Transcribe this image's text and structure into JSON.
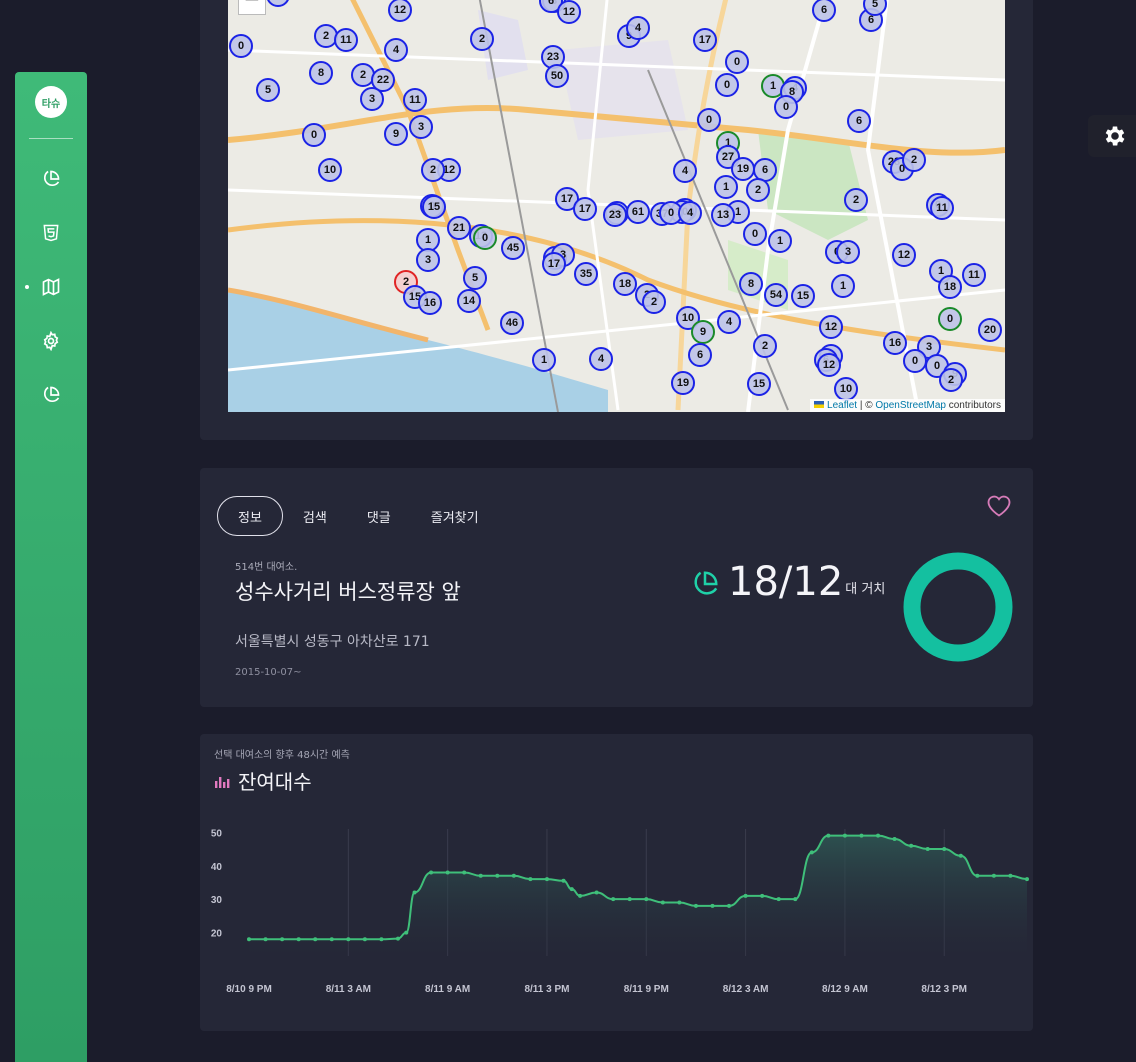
{
  "sidebar": {
    "logo_text": "타슈",
    "items": [
      {
        "name": "dashboard",
        "icon": "pie-chart-icon"
      },
      {
        "name": "html5",
        "icon": "html5-icon"
      },
      {
        "name": "map",
        "icon": "map-icon",
        "active": true
      },
      {
        "name": "settings",
        "icon": "gear-icon"
      },
      {
        "name": "stats",
        "icon": "pie-chart-icon"
      }
    ]
  },
  "map": {
    "zoom_out": "−",
    "attribution_leaflet": "Leaflet",
    "attribution_sep": " | © ",
    "attribution_osm": "OpenStreetMap",
    "attribution_tail": " contributors",
    "clusters": [
      "0",
      "12",
      "3",
      "6",
      "12",
      "6",
      "0",
      "2",
      "11",
      "4",
      "2",
      "9",
      "4",
      "17",
      "6",
      "0",
      "0",
      "8",
      "2",
      "22",
      "23",
      "1",
      "5",
      "50",
      "0",
      "4",
      "3",
      "11",
      "8",
      "0",
      "6",
      "9",
      "3",
      "0",
      "10",
      "12",
      "2",
      "1",
      "27",
      "28",
      "4",
      "19",
      "6",
      "1",
      "2",
      "0",
      "17",
      "2",
      "4",
      "1",
      "10",
      "0",
      "15",
      "17",
      "26",
      "61",
      "37",
      "23",
      "0",
      "4",
      "0",
      "13",
      "11",
      "21",
      "13",
      "0",
      "0",
      "1",
      "45",
      "4",
      "3",
      "0",
      "3",
      "1",
      "1",
      "12",
      "3",
      "17",
      "35",
      "2",
      "18",
      "5",
      "1",
      "11",
      "2",
      "18",
      "8",
      "1",
      "15",
      "16",
      "54",
      "15",
      "14",
      "2",
      "46",
      "10",
      "9",
      "4",
      "12",
      "0",
      "20",
      "6",
      "16",
      "3",
      "2",
      "1",
      "4",
      "7",
      "0",
      "6",
      "0",
      "12",
      "9",
      "2",
      "19",
      "10",
      "15",
      "5",
      "2"
    ],
    "colors": {
      "cluster_border": "#1b23e6",
      "cluster_fill": "#bec3e8",
      "green_border": "#1a8a2a",
      "red_border": "#e02424"
    }
  },
  "info": {
    "tabs": [
      "정보",
      "검색",
      "댓글",
      "즐겨찾기"
    ],
    "active_tab": "정보",
    "station_no": "514번 대여소.",
    "station_name": "성수사거리 버스정류장 앞",
    "address": "서울특별시 성동구 아차산로 171",
    "since": "2015-10-07~",
    "count_available": "18",
    "count_total": "12",
    "count_unit": "대 거치",
    "ring_color": "#14c0a0"
  },
  "chart": {
    "subtitle": "선택 대여소의 향후 48시간 예측",
    "title": "잔여대수"
  },
  "chart_data": {
    "type": "area",
    "x_ticks": [
      "8/10 9 PM",
      "8/11 3 AM",
      "8/11 9 AM",
      "8/11 3 PM",
      "8/11 9 PM",
      "8/12 3 AM",
      "8/12 9 AM",
      "8/12 3 PM"
    ],
    "y_ticks": [
      20,
      30,
      40,
      50
    ],
    "ylim": [
      13,
      51
    ],
    "x_hours": [
      0,
      1,
      2,
      3,
      4,
      5,
      6,
      7,
      8,
      9,
      9.5,
      10,
      11,
      12,
      13,
      14,
      15,
      16,
      17,
      18,
      19,
      19.5,
      20,
      21,
      22,
      23,
      24,
      25,
      26,
      27,
      28,
      29,
      30,
      31,
      32,
      33,
      34,
      35,
      36,
      37,
      38,
      39,
      40,
      41,
      42,
      43,
      44,
      45,
      46,
      47
    ],
    "values": [
      18,
      18,
      18,
      18,
      18,
      18,
      18,
      18,
      18,
      18.2,
      20,
      32,
      38,
      38,
      38,
      37,
      37,
      37,
      36,
      36,
      35.5,
      33,
      31,
      32,
      30,
      30,
      30,
      29,
      29,
      28,
      28,
      28,
      31,
      31,
      30,
      30,
      44,
      49,
      49,
      49,
      49,
      48,
      46,
      45,
      45,
      43,
      37,
      37,
      37,
      36
    ],
    "colors": {
      "line": "#3fbf7a",
      "fill_top": "#2f5a55",
      "fill_bottom": "#252737",
      "grid": "#3a3c4d"
    }
  }
}
